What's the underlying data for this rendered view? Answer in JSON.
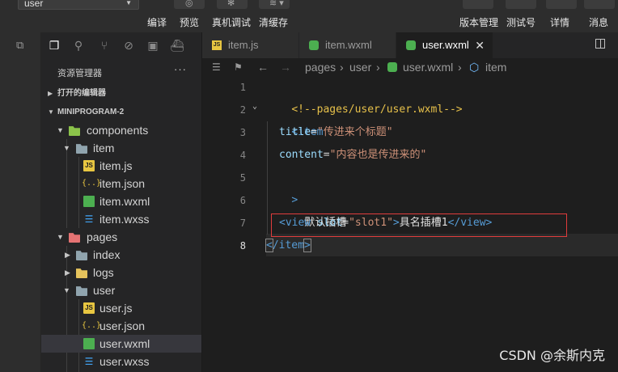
{
  "toolbar": {
    "project": "user",
    "left_labels": [
      "编译",
      "预览",
      "真机调试",
      "清缓存"
    ],
    "right_labels": [
      "版本管理",
      "测试号",
      "详情",
      "消息"
    ]
  },
  "sidebar": {
    "title": "资源管理器",
    "more": "···",
    "open_editors": "打开的编辑器",
    "project_section": "MINIPROGRAM-2",
    "tree": [
      {
        "label": "components"
      },
      {
        "label": "item"
      },
      {
        "label": "item.js"
      },
      {
        "label": "item.json"
      },
      {
        "label": "item.wxml"
      },
      {
        "label": "item.wxss"
      },
      {
        "label": "pages"
      },
      {
        "label": "index"
      },
      {
        "label": "logs"
      },
      {
        "label": "user"
      },
      {
        "label": "user.js"
      },
      {
        "label": "user.json"
      },
      {
        "label": "user.wxml"
      },
      {
        "label": "user.wxss"
      }
    ]
  },
  "tabs": [
    {
      "label": "item.js"
    },
    {
      "label": "item.wxml"
    },
    {
      "label": "user.wxml",
      "close": "✕"
    }
  ],
  "breadcrumb": {
    "sep": "›",
    "parts": [
      "pages",
      "user",
      "user.wxml",
      "item"
    ]
  },
  "editor": {
    "line_numbers": [
      "1",
      "2",
      "3",
      "4",
      "5",
      "6",
      "7",
      "8"
    ],
    "lines": {
      "l1_comment": "<!--pages/user/user.wxml-->",
      "l2_tag": "<item",
      "l3_attr": "title",
      "l3_eq": "=",
      "l3_val": "\"传进来个标题\"",
      "l4_attr": "content",
      "l4_eq": "=",
      "l4_val": "\"内容也是传进来的\"",
      "l5_close": ">",
      "l6_text": "默认插槽",
      "l7_open": "<view ",
      "l7_attr": "slot",
      "l7_eq": "=",
      "l7_val": "\"slot1\"",
      "l7_gt": ">",
      "l7_text": "具名插槽1",
      "l7_close": "</view>",
      "l8_open": "<",
      "l8_mid": "/item",
      "l8_gt": ">"
    }
  },
  "watermark": "CSDN @余斯内克",
  "colors": {
    "highlight_box": "#e03c3c",
    "comment": "#e6c04a",
    "tag": "#569cd6",
    "attr": "#9cdcfe",
    "string": "#ce9178"
  }
}
